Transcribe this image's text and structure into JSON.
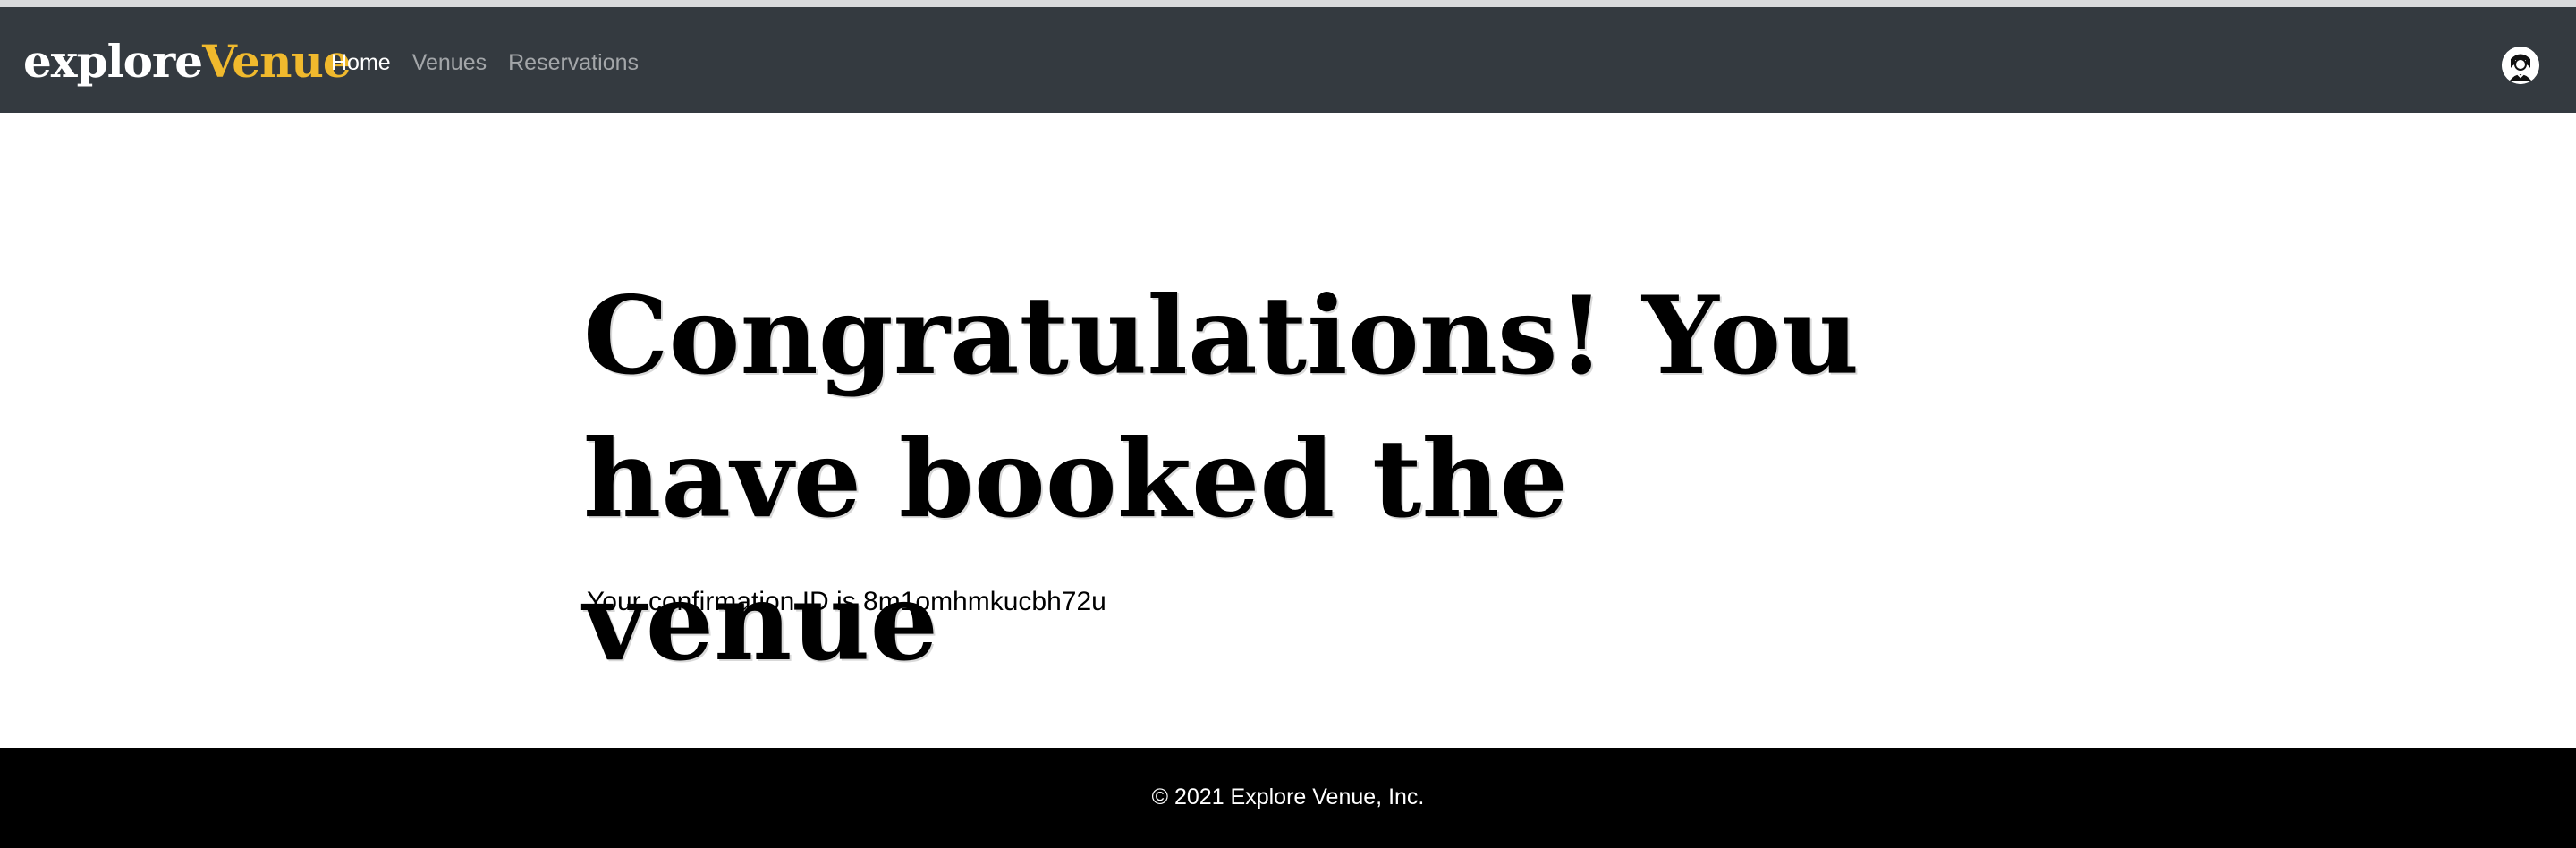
{
  "brand": {
    "part1": "explore",
    "part2": "Venue",
    "accent_color": "#f0b92d"
  },
  "nav": {
    "items": [
      {
        "label": "Home",
        "active": true
      },
      {
        "label": "Venues",
        "active": false
      },
      {
        "label": "Reservations",
        "active": false
      }
    ]
  },
  "user": {
    "icon": "user-avatar-icon"
  },
  "main": {
    "heading": "Congratulations! You have booked the venue",
    "confirmation_text": "Your confirmation ID is 8m1omhmkucbh72u"
  },
  "footer": {
    "text": "© 2021 Explore Venue, Inc."
  },
  "colors": {
    "navbar_bg": "#343a40",
    "footer_bg": "#000000"
  }
}
